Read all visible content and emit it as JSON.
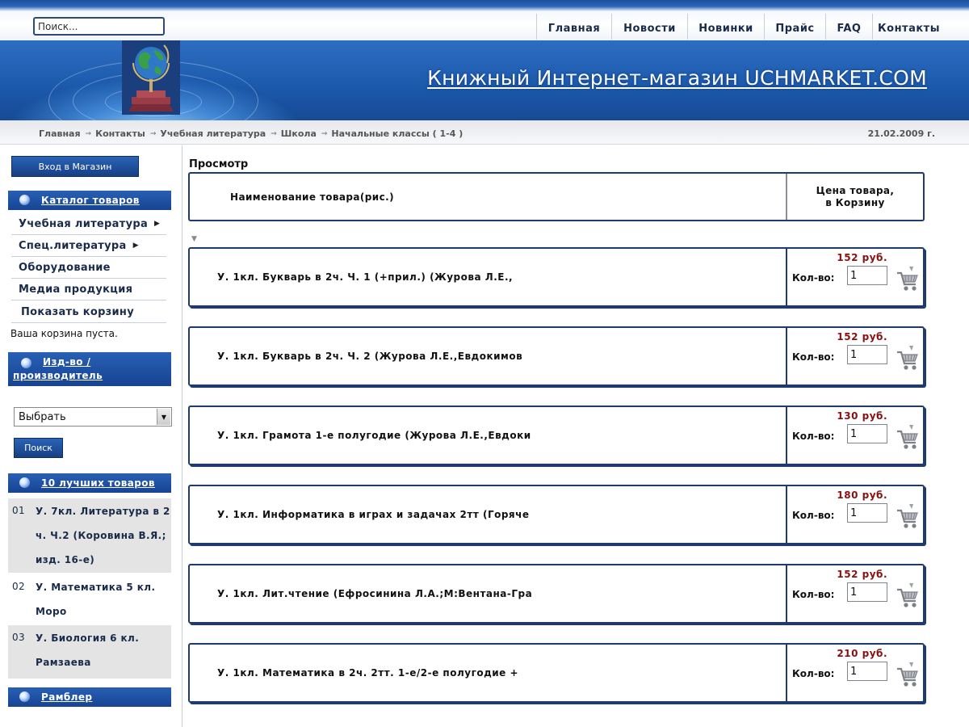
{
  "search": {
    "placeholder": "Поиск..."
  },
  "nav": [
    {
      "label": "Главная"
    },
    {
      "label": "Новости"
    },
    {
      "label": "Новинки"
    },
    {
      "label": "Прайс"
    },
    {
      "label": "FAQ"
    },
    {
      "label": "Контакты"
    }
  ],
  "banner": {
    "title": "Книжный Интернет-магазин UCHMARKET.COM"
  },
  "breadcrumb": {
    "items": [
      "Главная",
      "Контакты",
      "Учебная литература",
      "Школа",
      "Начальные классы ( 1-4 )"
    ],
    "date": "21.02.2009 г."
  },
  "sidebar": {
    "login_label": "Вход в Магазин",
    "catalog_title": "Каталог товаров",
    "catalog_items": [
      {
        "label": "Учебная литература"
      },
      {
        "label": "Спец.литература"
      },
      {
        "label": "Оборудование"
      },
      {
        "label": "Медиа продукция"
      }
    ],
    "cart_link": "Показать корзину",
    "cart_status": "Ваша корзина пуста.",
    "maker_title": "Изд-во / производитель",
    "maker_select": "Выбрать",
    "search_button": "Поиск",
    "top_title": "10 лучших товаров",
    "top_items": [
      {
        "num": "01",
        "title": "У. 7кл. Литература в 2 ч. Ч.2 (Коровина В.Я.; изд. 16-е)"
      },
      {
        "num": "02",
        "title": "У. Математика 5 кл. Моро"
      },
      {
        "num": "03",
        "title": "У. Биология 6 кл. Рамзаева"
      }
    ],
    "rambler_title": "Рамблер"
  },
  "main": {
    "heading": "Просмотр",
    "col_name": "Наименование товара(рис.)",
    "col_price_line1": "Цена товара,",
    "col_price_line2": "в Корзину",
    "qty_label": "Кол-во:",
    "products": [
      {
        "name": "У. 1кл. Букварь в 2ч. Ч. 1 (+прил.) (Журова Л.Е.,",
        "price": "152 руб.",
        "qty": "1"
      },
      {
        "name": "У. 1кл. Букварь в 2ч. Ч. 2 (Журова Л.Е.,Евдокимов",
        "price": "152 руб.",
        "qty": "1"
      },
      {
        "name": "У. 1кл. Грамота 1-е полугодие (Журова Л.Е.,Евдоки",
        "price": "130 руб.",
        "qty": "1"
      },
      {
        "name": "У. 1кл. Информатика в играх и задачах 2тт (Горяче",
        "price": "180 руб.",
        "qty": "1"
      },
      {
        "name": "У. 1кл. Лит.чтение (Ефросинина Л.А.;М:Вентана-Гра",
        "price": "152 руб.",
        "qty": "1"
      },
      {
        "name": "У. 1кл. Математика в 2ч. 2тт. 1-е/2-е полугодие +",
        "price": "210 руб.",
        "qty": "1"
      }
    ]
  },
  "colors": {
    "brand_blue": "#1c5aac",
    "nav_dark": "#1e3a6e",
    "price_red": "#8a1010"
  }
}
